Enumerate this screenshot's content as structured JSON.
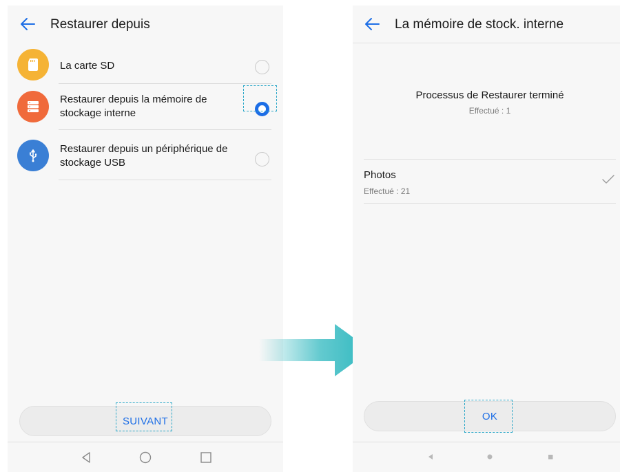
{
  "left_screen": {
    "title": "Restaurer depuis",
    "options": [
      {
        "label_line1": "La carte SD",
        "label_line2": "",
        "icon": "sd-card-icon",
        "icon_color": "#f5b335",
        "selected": false
      },
      {
        "label_line1": "Restaurer depuis la mémoire de",
        "label_line2": "stockage interne",
        "icon": "storage-icon",
        "icon_color": "#f06a3b",
        "selected": true
      },
      {
        "label_line1": "Restaurer depuis un périphérique de",
        "label_line2": "stockage USB",
        "icon": "usb-icon",
        "icon_color": "#3a7fd5",
        "selected": false
      }
    ],
    "next_button": "SUIVANT"
  },
  "right_screen": {
    "title": "La mémoire de stock. interne",
    "status_title": "Processus de Restaurer terminé",
    "status_sub": "Effectué : 1",
    "result": {
      "name": "Photos",
      "sub": "Effectué : 21"
    },
    "ok_button": "OK"
  },
  "colors": {
    "accent": "#1d6ee6",
    "highlight_dash": "#2aa7c8",
    "arrow": "#2fb8bf"
  }
}
